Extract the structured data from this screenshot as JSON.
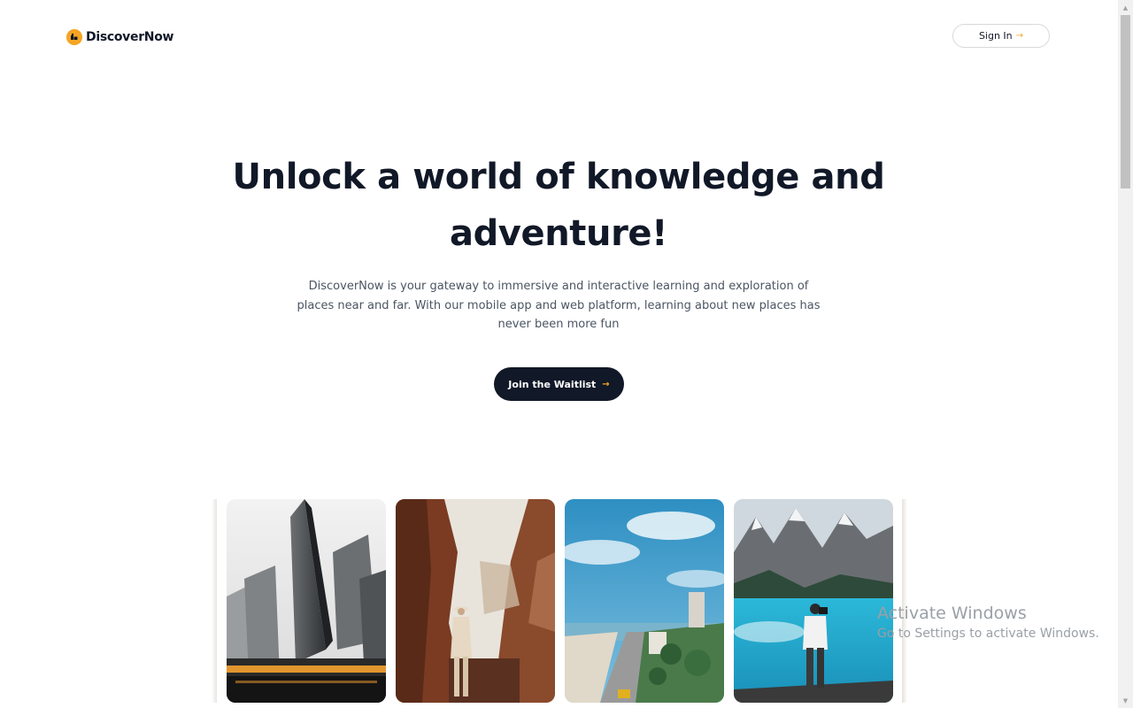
{
  "brand": {
    "name": "DiscoverNow",
    "logo_icon": "discovernow-logo-icon"
  },
  "header": {
    "signin_label": "Sign In",
    "signin_arrow": "→"
  },
  "hero": {
    "title": "Unlock a world of knowledge and adventure!",
    "subtitle": "DiscoverNow is your gateway to immersive and interactive learning and exploration of places near and far. With our mobile app and web platform, learning about new places has never been more fun",
    "cta_label": "Join the Waitlist",
    "cta_arrow": "→"
  },
  "gallery": {
    "images": [
      "city-skyscrapers-photo",
      "canyon-hiker-photo",
      "coastal-city-photo",
      "mountain-lake-photo"
    ]
  },
  "watermark": {
    "title": "Activate Windows",
    "subtitle": "Go to Settings to activate Windows."
  },
  "colors": {
    "accent": "#f5a524",
    "dark": "#111827",
    "text_muted": "#4b5563"
  }
}
